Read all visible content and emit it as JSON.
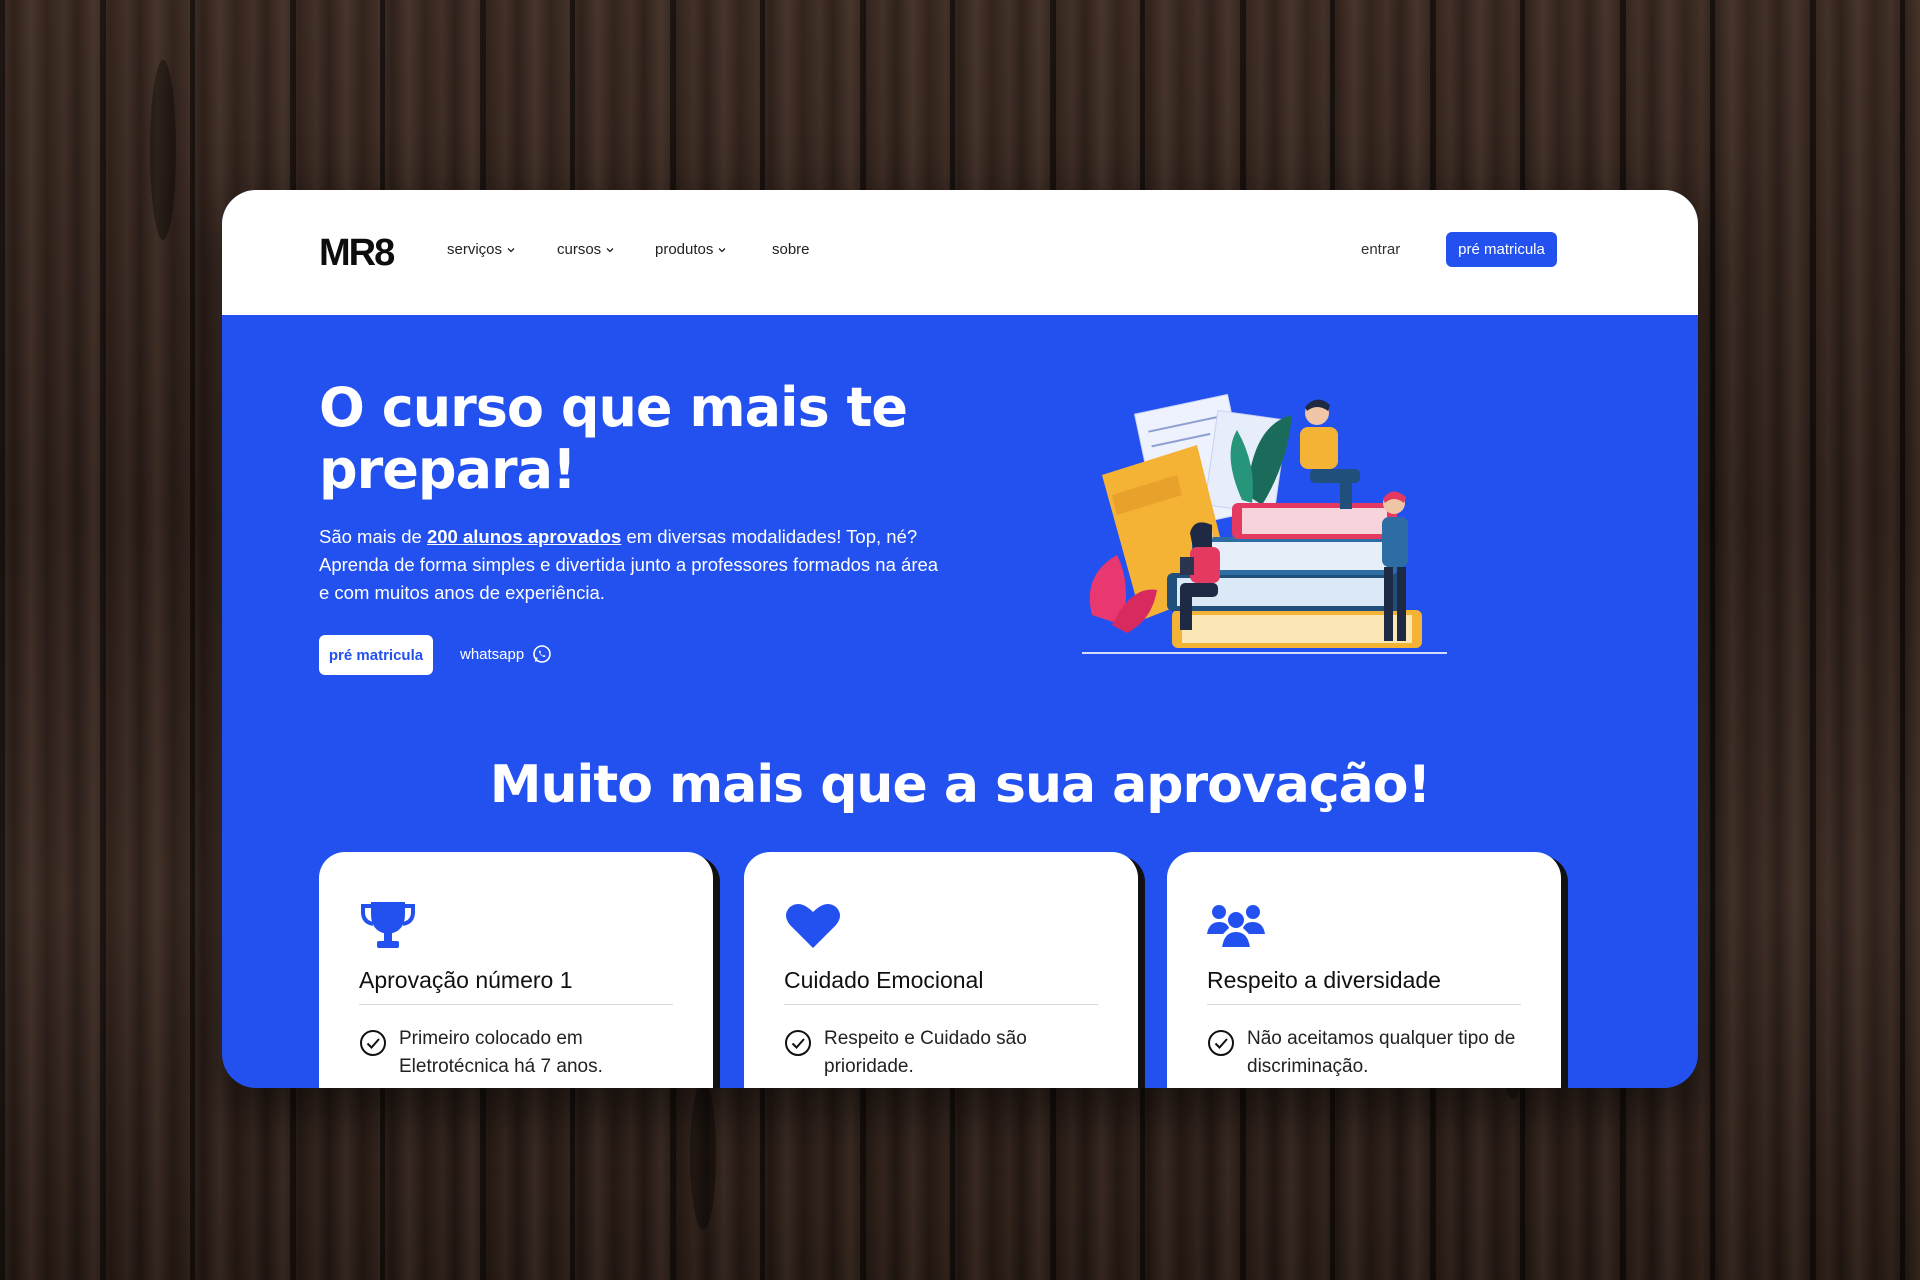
{
  "brand": {
    "logo": "MR8"
  },
  "nav": {
    "items": [
      {
        "label": "serviços",
        "dropdown": true
      },
      {
        "label": "cursos",
        "dropdown": true
      },
      {
        "label": "produtos",
        "dropdown": true
      },
      {
        "label": "sobre",
        "dropdown": false
      }
    ],
    "login_label": "entrar",
    "cta_label": "pré matricula"
  },
  "hero": {
    "title": "O curso que mais te prepara!",
    "text_before": "São mais de ",
    "text_highlight": "200 alunos aprovados",
    "text_after": " em diversas modalidades! Top, né? Aprenda de forma simples e divertida junto a professores formados na área e com muitos anos de experiência.",
    "cta_label": "pré matricula",
    "whatsapp_label": "whatsapp",
    "whatsapp_icon": "whatsapp-icon"
  },
  "features": {
    "title": "Muito mais que a sua aprovação!",
    "cards": [
      {
        "icon": "trophy-icon",
        "title": "Aprovação número 1",
        "text": "Primeiro colocado em Eletrotécnica há 7 anos."
      },
      {
        "icon": "heart-icon",
        "title": "Cuidado Emocional",
        "text": "Respeito e Cuidado são prioridade."
      },
      {
        "icon": "users-icon",
        "title": "Respeito a diversidade",
        "text": "Não aceitamos qualquer tipo de discriminação."
      }
    ]
  },
  "colors": {
    "primary": "#2351f0",
    "background": "#ffffff",
    "text_dark": "#111111"
  }
}
